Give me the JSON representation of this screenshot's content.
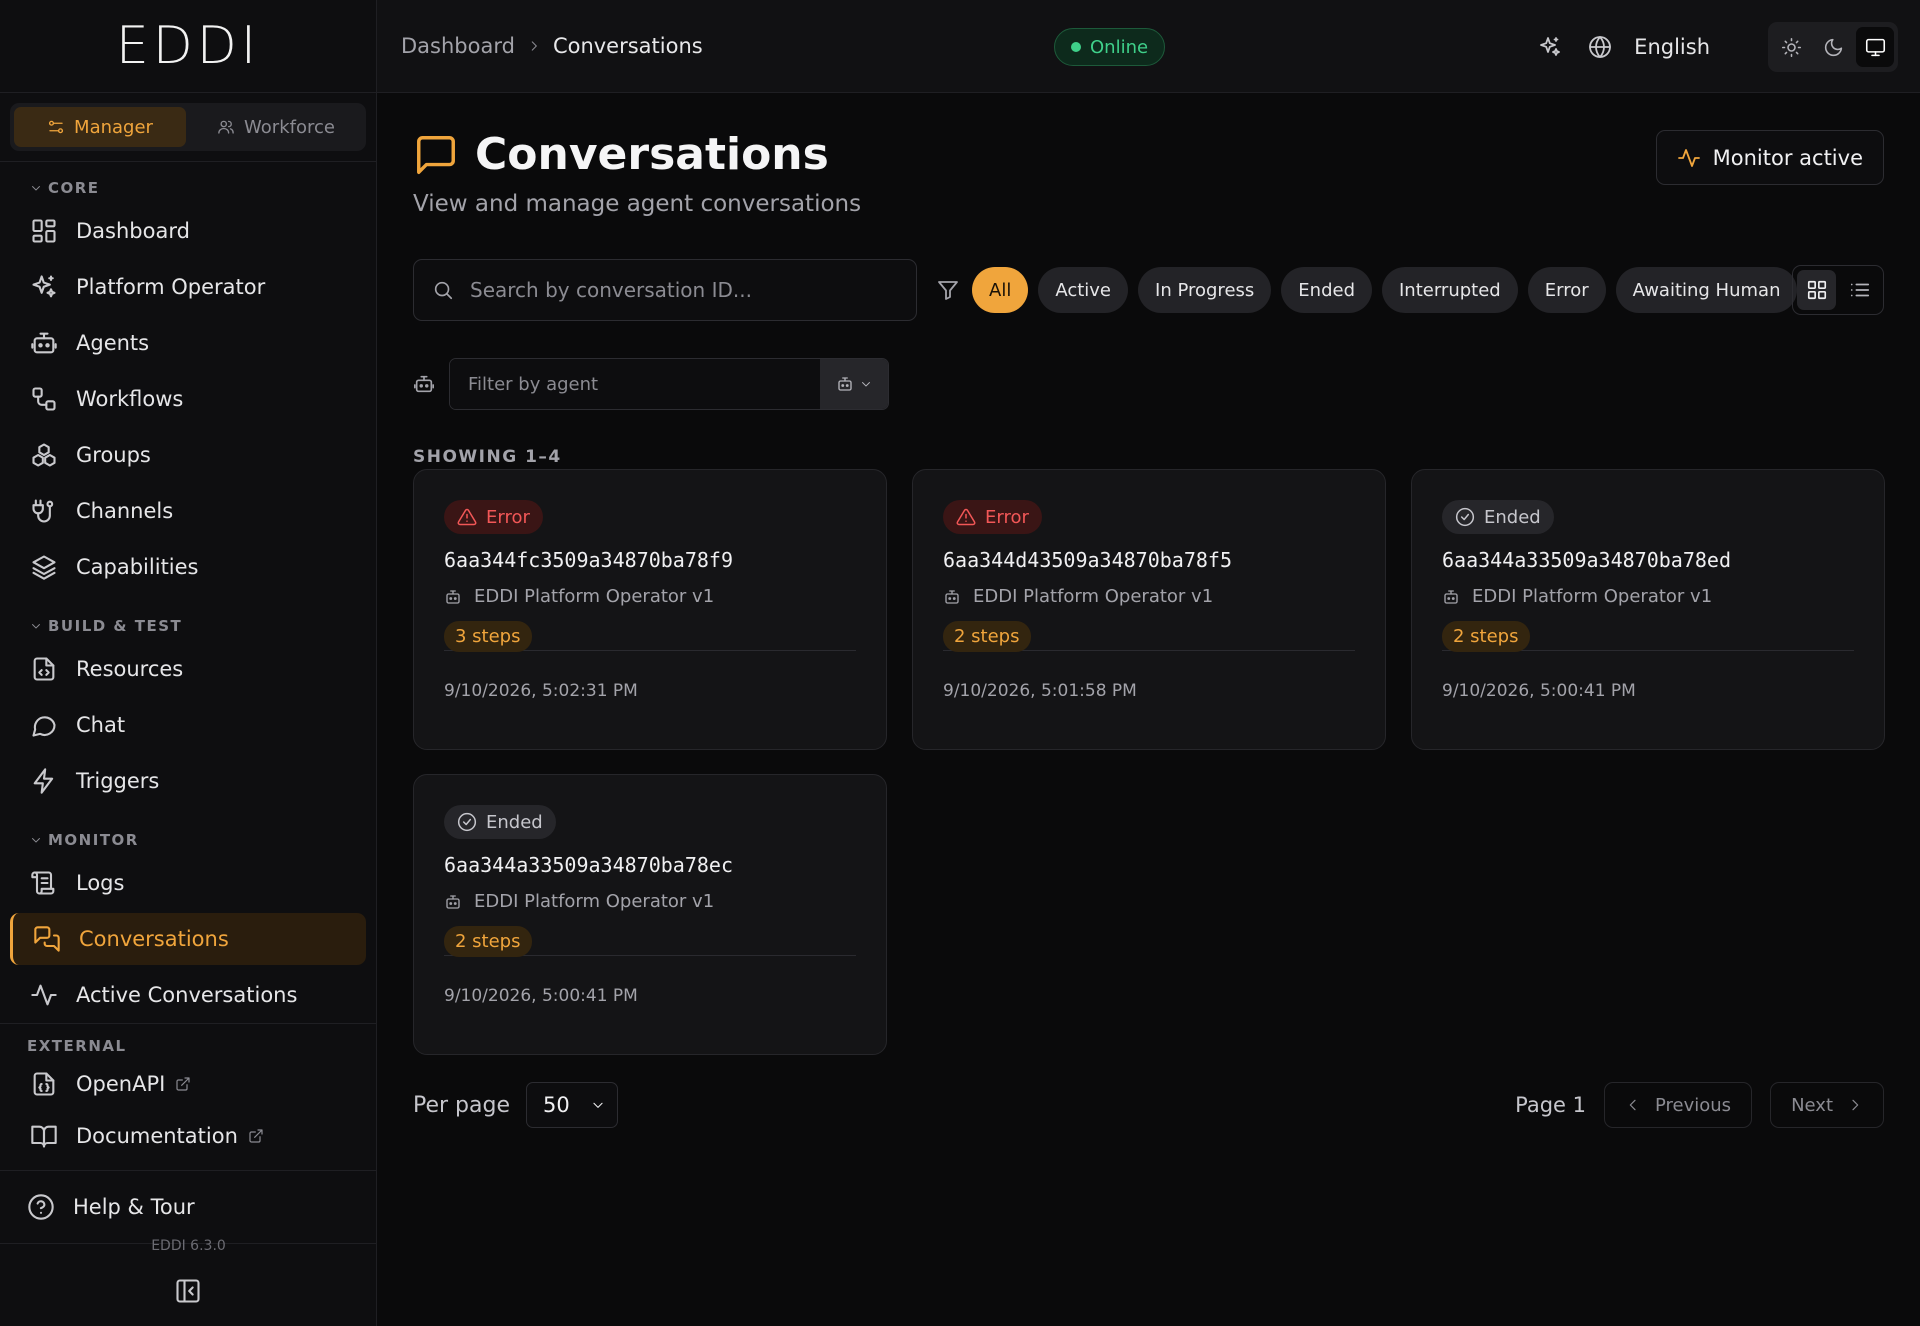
{
  "sidebar": {
    "logo": "EDDI",
    "modes": [
      {
        "label": "Manager",
        "icon": "sliders-icon",
        "active": true
      },
      {
        "label": "Workforce",
        "icon": "users-icon",
        "active": false
      }
    ],
    "sections": {
      "core": "CORE",
      "build": "BUILD & TEST",
      "monitor": "MONITOR",
      "external": "EXTERNAL"
    },
    "items": {
      "dashboard": "Dashboard",
      "platform_operator": "Platform Operator",
      "agents": "Agents",
      "workflows": "Workflows",
      "groups": "Groups",
      "channels": "Channels",
      "capabilities": "Capabilities",
      "resources": "Resources",
      "chat": "Chat",
      "triggers": "Triggers",
      "logs": "Logs",
      "conversations": "Conversations",
      "active_conversations": "Active Conversations",
      "openapi": "OpenAPI",
      "documentation": "Documentation",
      "help": "Help & Tour"
    },
    "version": "EDDI 6.3.0"
  },
  "topbar": {
    "breadcrumb": [
      "Dashboard",
      "Conversations"
    ],
    "status": "Online",
    "language": "English",
    "theme_active": "system"
  },
  "page": {
    "title": "Conversations",
    "subtitle": "View and manage agent conversations",
    "monitor_button": "Monitor active",
    "search_placeholder": "Search by conversation ID...",
    "filters": [
      "All",
      "Active",
      "In Progress",
      "Ended",
      "Interrupted",
      "Error",
      "Awaiting Human"
    ],
    "active_filter": "All",
    "agent_filter_placeholder": "Filter by agent",
    "showing": "SHOWING 1–4"
  },
  "conversations": [
    {
      "status": "Error",
      "id": "6aa344fc3509a34870ba78f9",
      "agent": "EDDI Platform Operator v1",
      "steps": "3 steps",
      "time": "9/10/2026, 5:02:31 PM"
    },
    {
      "status": "Error",
      "id": "6aa344d43509a34870ba78f5",
      "agent": "EDDI Platform Operator v1",
      "steps": "2 steps",
      "time": "9/10/2026, 5:01:58 PM"
    },
    {
      "status": "Ended",
      "id": "6aa344a33509a34870ba78ed",
      "agent": "EDDI Platform Operator v1",
      "steps": "2 steps",
      "time": "9/10/2026, 5:00:41 PM"
    },
    {
      "status": "Ended",
      "id": "6aa344a33509a34870ba78ec",
      "agent": "EDDI Platform Operator v1",
      "steps": "2 steps",
      "time": "9/10/2026, 5:00:41 PM"
    }
  ],
  "pagination": {
    "per_page_label": "Per page",
    "per_page_value": "50",
    "page_label": "Page 1",
    "previous": "Previous",
    "next": "Next"
  },
  "colors": {
    "accent": "#f0a53c",
    "online": "#3fd08a",
    "error": "#f25757"
  }
}
